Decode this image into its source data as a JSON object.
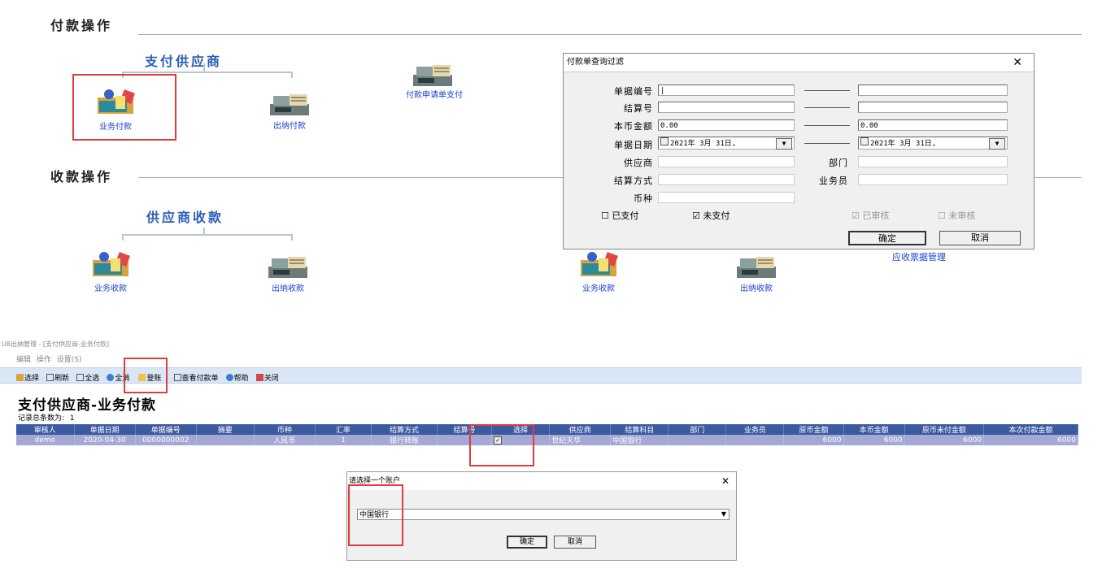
{
  "payment_section": {
    "title": "付款操作",
    "group_title": "支付供应商",
    "icons": {
      "business_payment": "业务付款",
      "cashier_payment": "出纳付款",
      "apply_payment": "付款申请单支付"
    }
  },
  "receipt_section": {
    "title": "收款操作",
    "group_title": "供应商收款",
    "icons": {
      "business_receipt": "业务收款",
      "cashier_receipt": "出纳收款",
      "business_receipt_2": "业务收款",
      "cashier_receipt_2": "出纳收款",
      "bill_manage": "应收票据管理"
    }
  },
  "filter_dialog": {
    "title": "付款单查询过滤",
    "labels": {
      "doc_no": "单据编号",
      "settle_no": "结算号",
      "amount": "本币金额",
      "doc_date": "单据日期",
      "supplier": "供应商",
      "dept": "部门",
      "settle_method": "结算方式",
      "salesman": "业务员",
      "currency": "币种"
    },
    "values": {
      "amount_from": "0.00",
      "amount_to": "0.00",
      "date_from": "2021年 3月 31日,",
      "date_to": "2021年 3月 31日,"
    },
    "checks": {
      "paid": "已支付",
      "unpaid": "未支付",
      "audited": "已审核",
      "unaudited": "未审核"
    },
    "ok": "确定",
    "cancel": "取消"
  },
  "app": {
    "breadcrumb": "U8出纳管理 - [支付供应商-业务付款]",
    "menu": [
      "编辑",
      "操作",
      "设置(S)"
    ],
    "toolbar": [
      "选择",
      "刷新",
      "全选",
      "全消",
      "登账",
      "查看付款单",
      "帮助",
      "关闭"
    ],
    "page_title": "支付供应商-业务付款",
    "record_count_label": "记录总条数为:",
    "record_count": "1",
    "columns": [
      "审核人",
      "单据日期",
      "单据编号",
      "摘要",
      "币种",
      "汇率",
      "结算方式",
      "结算号",
      "选择",
      "供应商",
      "结算科目",
      "部门",
      "业务员",
      "原币金额",
      "本币金额",
      "原币未付金额",
      "本次付款金额"
    ],
    "row": {
      "auditor": "demo",
      "date": "2020-04-30",
      "doc_no": "0000000002",
      "summary": "",
      "currency": "人民币",
      "rate": "1",
      "settle_method": "银行转账",
      "settle_no": "",
      "supplier": "世纪天华",
      "account": "中国银行",
      "dept": "",
      "salesman": "",
      "orig_amount": "6000",
      "local_amount": "6000",
      "orig_unpaid": "6000",
      "pay_amount": "6000"
    }
  },
  "account_dialog": {
    "title": "请选择一个账户",
    "selected": "中国银行",
    "ok": "确定",
    "cancel": "取消"
  }
}
